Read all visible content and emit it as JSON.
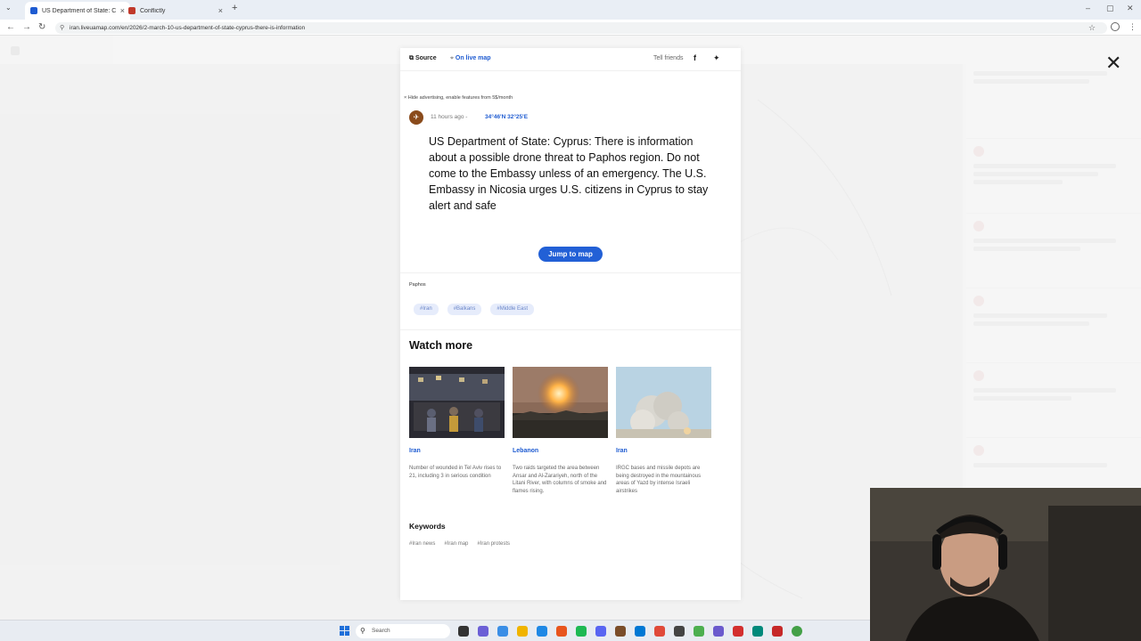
{
  "browser": {
    "tabs": [
      {
        "title": "US Department of State: Cyprus",
        "active": true,
        "favicon_color": "#1e5bd1"
      },
      {
        "title": "Conflictly",
        "active": false,
        "favicon_color": "#c0392b"
      }
    ],
    "new_tab": "+",
    "url": "iran.liveuamap.com/en/2026/2-march-10-us-department-of-state-cyprus-there-is-information"
  },
  "modal": {
    "header": {
      "source_label": "Source",
      "live_map_label": "On live map",
      "tell_friends": "Tell friends",
      "facebook_glyph": "f",
      "twitter_glyph": "✦"
    },
    "hide_ad": "× Hide advertising, enable features from 5$/month",
    "time_ago": "11 hours ago -",
    "coords": "34°46'N 32°25'E",
    "headline": "US Department of State: Cyprus: There is information about a possible drone threat to Paphos region. Do not come to the Embassy unless of an emergency. The U.S. Embassy in Nicosia urges U.S. citizens in Cyprus to stay alert and safe",
    "jump_button": "Jump to map",
    "place": "Paphos",
    "tags": [
      "#Iran",
      "#Balkans",
      "#Middle East"
    ],
    "watch_more": "Watch more",
    "cards": [
      {
        "tag": "Iran",
        "desc": "Number of wounded in Tel Aviv rises to 21, including 3 in serious condition"
      },
      {
        "tag": "Lebanon",
        "desc": "Two raids targeted the area between Ansar and Al-Zarariyeh, north of the Litani River, with columns of smoke and flames rising."
      },
      {
        "tag": "Iran",
        "desc": "IRGC bases and missile depots are being destroyed in the mountainous areas of Yazd by intense Israeli airstrikes"
      }
    ],
    "keywords_title": "Keywords",
    "keywords": [
      "#Iran news",
      "#Iran map",
      "#Iran protests"
    ]
  },
  "close_glyph": "✕",
  "taskbar": {
    "search_placeholder": "Search"
  },
  "colors": {
    "accent": "#2260d6",
    "link": "#1e5bd1",
    "tag_bg": "#e6ecfb"
  }
}
